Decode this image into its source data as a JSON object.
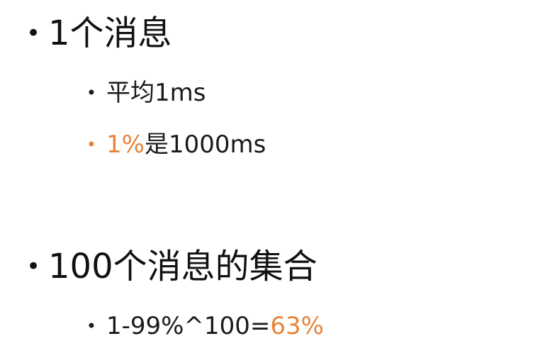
{
  "slide": {
    "bullet_glyph": "•",
    "accent_color": "#e8843a",
    "items": [
      {
        "text": "1个消息"
      },
      {
        "text": "平均1ms"
      },
      {
        "highlight": "1%",
        "rest": "是1000ms"
      },
      {
        "text": "100个消息的集合"
      },
      {
        "prefix": "1-99%^100=",
        "highlight": "63%"
      }
    ]
  }
}
